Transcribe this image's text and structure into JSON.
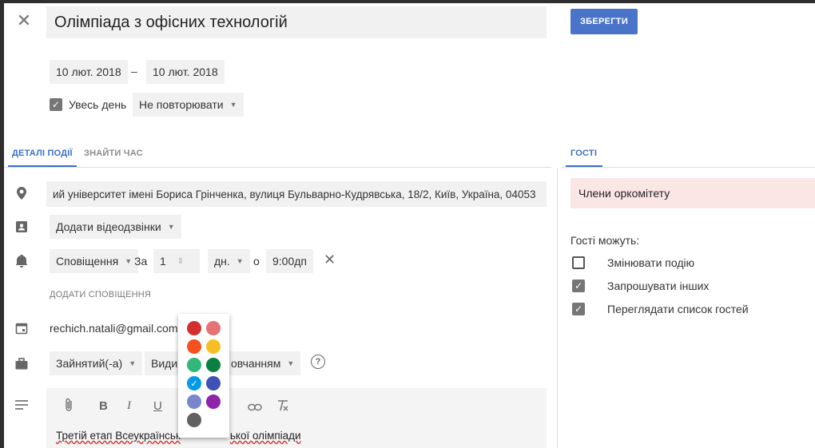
{
  "header": {
    "close_glyph": "✕",
    "title": "Олімпіада з офісних технологій",
    "save_label": "ЗБЕРЕГТИ"
  },
  "dates": {
    "start": "10 лют. 2018",
    "separator": "–",
    "end": "10 лют. 2018",
    "all_day_label": "Увесь день",
    "all_day_checked": true,
    "repeat_label": "Не повторювати"
  },
  "tabs": {
    "details": "ДЕТАЛІ ПОДІЇ",
    "find_time": "ЗНАЙТИ ЧАС",
    "guests": "ГОСТІ"
  },
  "details": {
    "location": "ий університет імені Бориса Грінченка, вулиця Бульварно-Кудрявська, 18/2, Київ, Україна, 04053",
    "video_conf": "Додати відеодзвінки",
    "notification": {
      "type": "Сповіщення",
      "prefix": "За",
      "amount": "1",
      "unit": "дн.",
      "at": "о",
      "time": "9:00дп"
    },
    "add_notification": "ДОДАТИ СПОВІЩЕННЯ",
    "calendar_email": "rechich.natali@gmail.com",
    "busy": "Зайнятий(-а)",
    "visibility_visible": "Видим",
    "visibility_tail": "овчанням",
    "description_text": "Третій етап Всеукраїнськ",
    "description_tail": "ької олімпіади"
  },
  "toolbar": {
    "attach_icon": "paperclip-icon",
    "bold": "B",
    "italic": "I",
    "underline": "U",
    "link_icon": "link-icon",
    "clear_format_icon": "clear-format-icon"
  },
  "guests": {
    "organizer_group": "Члени оркомітету",
    "permissions_title": "Гості можуть:",
    "permissions": [
      {
        "label": "Змінювати подію",
        "checked": false
      },
      {
        "label": "Запрошувати інших",
        "checked": true
      },
      {
        "label": "Переглядати список гостей",
        "checked": true
      }
    ]
  },
  "colors": {
    "accent": "#4a74c9",
    "palette": [
      "#d32f2f",
      "#e57373",
      "#f4511e",
      "#f6bf26",
      "#33b679",
      "#0b8043",
      "#039be5",
      "#3f51b5",
      "#7986cb",
      "#8e24aa",
      "#616161"
    ],
    "selected_index": 6
  }
}
